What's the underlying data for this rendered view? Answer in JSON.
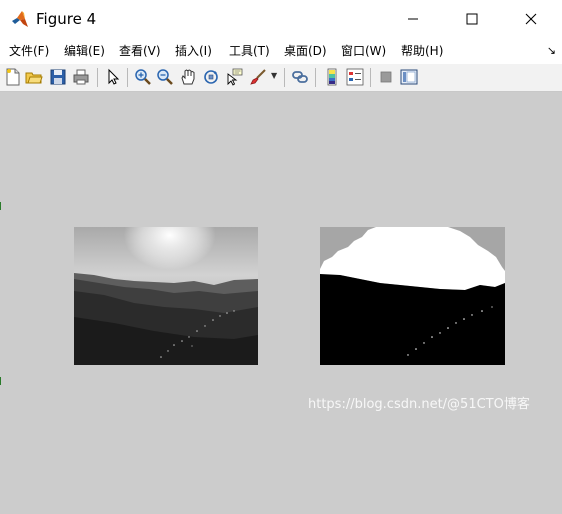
{
  "window": {
    "title": "Figure 4",
    "controls": {
      "minimize": "minimize",
      "maximize": "maximize",
      "close": "close"
    }
  },
  "menubar": {
    "items": [
      {
        "label": "文件(F)"
      },
      {
        "label": "编辑(E)"
      },
      {
        "label": "查看(V)"
      },
      {
        "label": "插入(I)"
      },
      {
        "label": "工具(T)"
      },
      {
        "label": "桌面(D)"
      },
      {
        "label": "窗口(W)"
      },
      {
        "label": "帮助(H)"
      }
    ],
    "overflow_glyph": "↘"
  },
  "toolbar": {
    "icons": [
      "new-figure-icon",
      "open-file-icon",
      "save-icon",
      "print-icon",
      "pointer-icon",
      "zoom-in-icon",
      "zoom-out-icon",
      "pan-hand-icon",
      "rotate-3d-icon",
      "data-cursor-icon",
      "brush-icon",
      "link-plot-icon",
      "colorbar-icon",
      "legend-icon",
      "hide-plot-tools-icon",
      "show-plot-tools-icon"
    ]
  },
  "figure": {
    "background": "#cccccc",
    "left_image": "grayscale-mountain-landscape",
    "right_image": "binary-threshold-mountain-landscape"
  },
  "watermark": {
    "text": "https://blog.csdn.net/@51CTO博客"
  },
  "colors": {
    "accent": "#0072bd",
    "titlebar": "#ffffff",
    "figure_bg": "#cccccc"
  }
}
